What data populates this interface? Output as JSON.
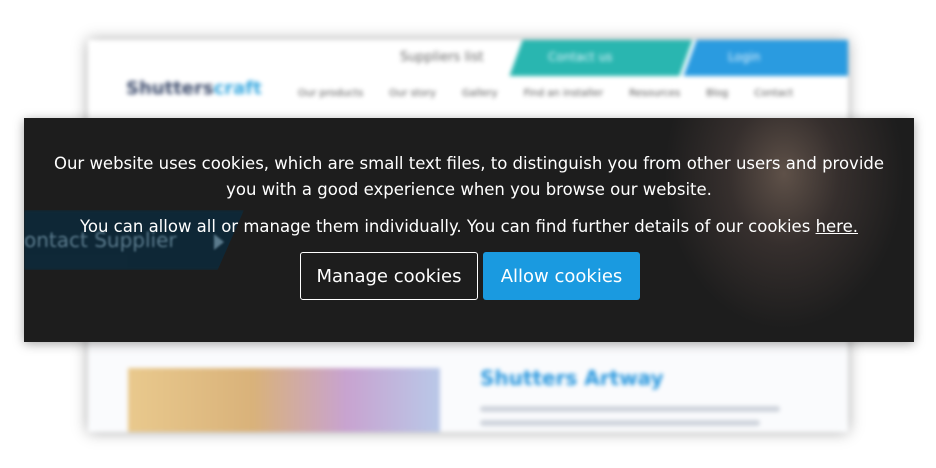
{
  "background_site": {
    "suppliers_label": "Suppliers list",
    "teal_tab_label": "Contact us",
    "blue_tab_label": "Login",
    "logo_main": "Shutters",
    "logo_accent": "craft",
    "nav": [
      "Our products",
      "Our story",
      "Gallery",
      "Find an installer",
      "Resources",
      "Blog",
      "Contact"
    ],
    "contact_supplier": "ontact Supplier",
    "article_title": "Shutters Artway"
  },
  "cookie_banner": {
    "message_line1": "Our website uses cookies, which are small text files, to distinguish you from other users and provide",
    "message_line2": "you with a good experience when you browse our website.",
    "message_manage_prefix": "You can allow all or manage them individually. You can find further details of our cookies ",
    "link_here": "here.",
    "manage_button": "Manage cookies",
    "allow_button": "Allow cookies"
  },
  "colors": {
    "banner_bg": "#1d1d1d",
    "allow_button_bg": "#1a9ae0",
    "teal_accent": "#29b6b0",
    "blue_accent": "#2a9be0"
  }
}
